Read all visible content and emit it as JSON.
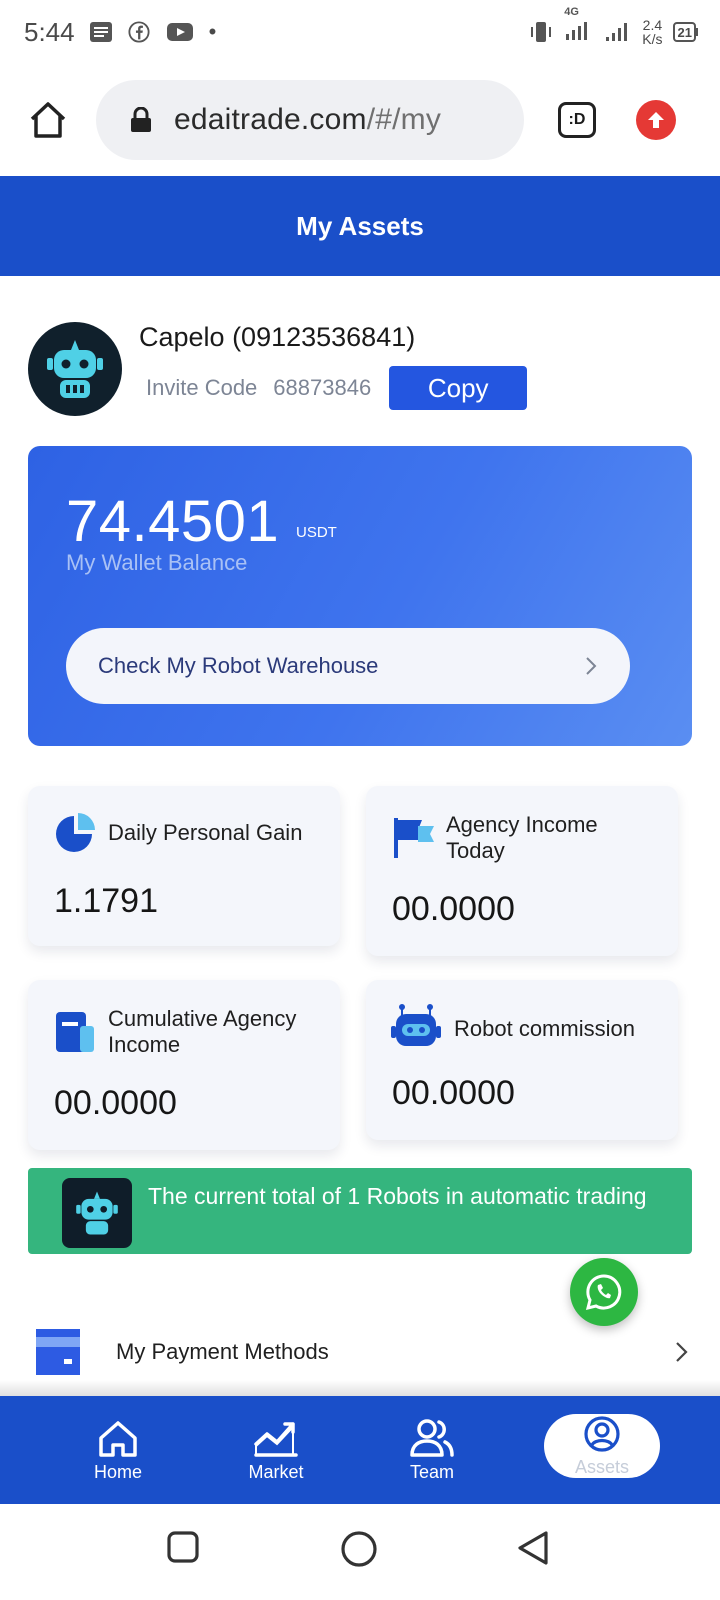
{
  "status_bar": {
    "time": "5:44",
    "speed_value": "2.4",
    "speed_unit": "K/s",
    "network": "4G",
    "battery": "21"
  },
  "browser": {
    "url_main": "edaitrade.com",
    "url_path": "/#/my",
    "tab_label": ":D"
  },
  "header": {
    "title": "My Assets"
  },
  "profile": {
    "name": "Capelo (09123536841)",
    "invite_label": "Invite Code",
    "invite_code": "68873846",
    "copy_label": "Copy"
  },
  "wallet": {
    "balance": "74.4501",
    "unit": "USDT",
    "label": "My Wallet Balance",
    "warehouse_label": "Check My Robot Warehouse"
  },
  "stats": [
    {
      "title": "Daily Personal Gain",
      "value": "1.1791",
      "icon": "pie-chart-icon"
    },
    {
      "title": "Agency Income Today",
      "value": "00.0000",
      "icon": "flag-icon"
    },
    {
      "title": "Cumulative Agency Income",
      "value": "00.0000",
      "icon": "document-icon"
    },
    {
      "title": "Robot commission",
      "value": "00.0000",
      "icon": "robot-icon"
    }
  ],
  "banner": {
    "text": "The current total of 1 Robots in automatic trading"
  },
  "menu": {
    "payment_label": "My Payment Methods"
  },
  "bottom_nav": {
    "items": [
      {
        "label": "Home"
      },
      {
        "label": "Market"
      },
      {
        "label": "Team"
      },
      {
        "label": "Assets"
      }
    ]
  },
  "colors": {
    "primary": "#1a4fc9",
    "copy_button": "#2456e0",
    "banner": "#35b57e",
    "whatsapp": "#2db742"
  }
}
